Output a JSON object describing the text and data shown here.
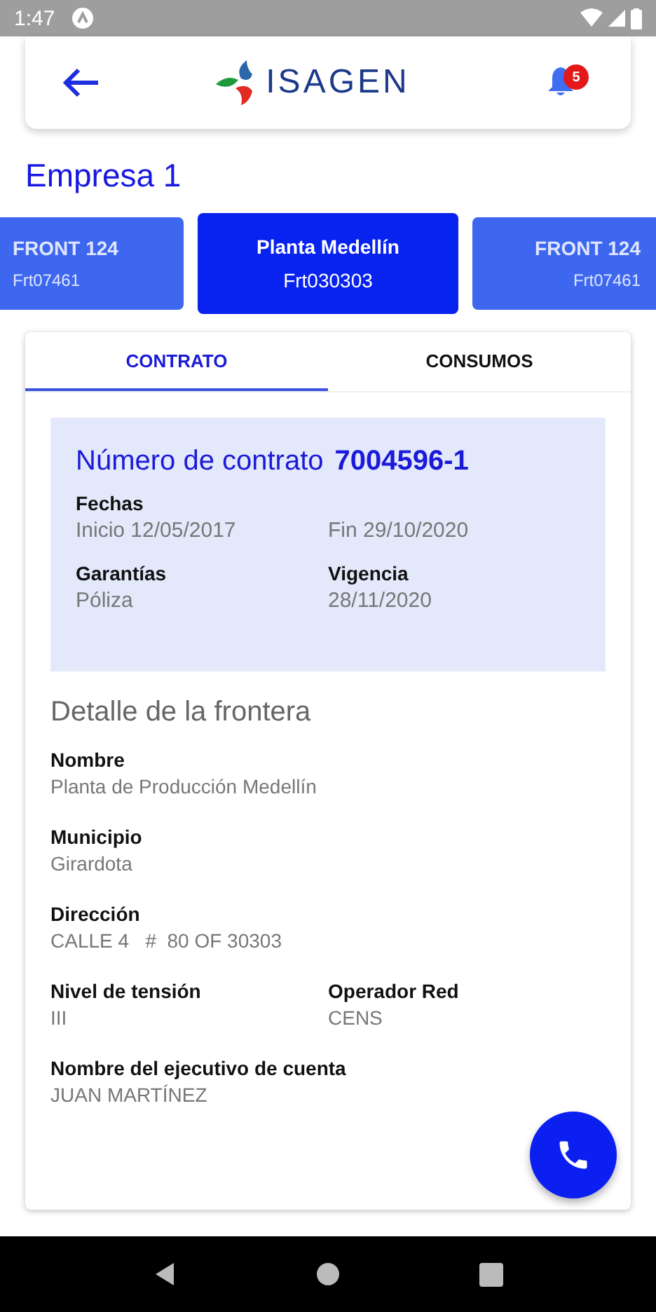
{
  "status_bar": {
    "time": "1:47"
  },
  "header": {
    "logo_text": "ISAGEN",
    "notification_count": "5"
  },
  "company": "Empresa 1",
  "fronts": [
    {
      "name": "FRONT 124",
      "code": "Frt07461",
      "selected": false
    },
    {
      "name": "Planta Medellín",
      "code": "Frt030303",
      "selected": true
    },
    {
      "name": "FRONT 124",
      "code": "Frt07461",
      "selected": false
    }
  ],
  "tabs": [
    {
      "label": "CONTRATO",
      "selected": true
    },
    {
      "label": "CONSUMOS",
      "selected": false
    }
  ],
  "contract": {
    "title": "Número de contrato",
    "number": "7004596-1",
    "rows": [
      [
        {
          "label": "Fechas",
          "value": "Inicio 12/05/2017"
        },
        {
          "value": "Fin 29/10/2020"
        }
      ],
      [
        {
          "label": "Garantías",
          "value": "Póliza"
        },
        {
          "label": "Vigencia",
          "value": "28/11/2020"
        }
      ]
    ]
  },
  "detail": {
    "title": "Detalle de la frontera",
    "rows": [
      [
        {
          "label": "Nombre",
          "value": "Planta de Producción Medellín"
        }
      ],
      [
        {
          "label": "Municipio",
          "value": "Girardota"
        }
      ],
      [
        {
          "label": "Dirección",
          "value": "CALLE 4   #  80 OF 30303"
        }
      ],
      [
        {
          "label": "Nivel de tensión",
          "value": "III"
        },
        {
          "label": "Operador Red",
          "value": "CENS"
        }
      ],
      [
        {
          "label": "Nombre del ejecutivo de cuenta",
          "value": "JUAN MARTÍNEZ"
        }
      ]
    ]
  }
}
